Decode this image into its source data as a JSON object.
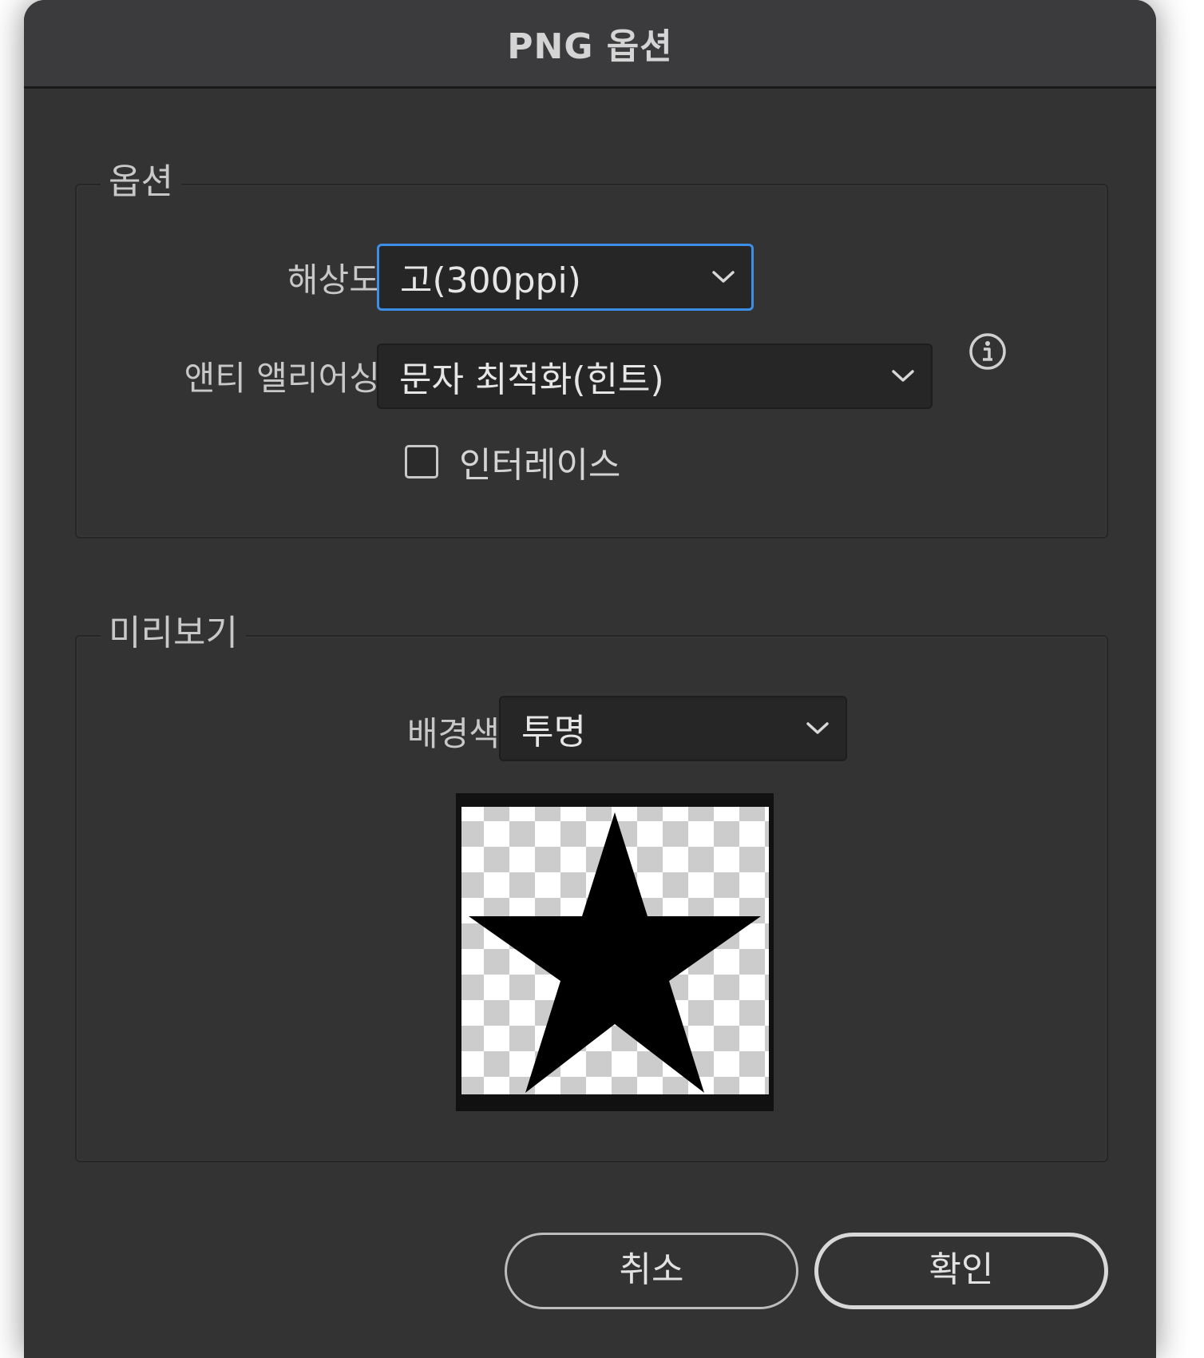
{
  "dialog": {
    "title": "PNG 옵션"
  },
  "options_group": {
    "legend": "옵션",
    "resolution": {
      "label": "해상도:",
      "value": "고(300ppi)"
    },
    "antialias": {
      "label": "앤티 앨리어싱:",
      "value": "문자 최적화(힌트)"
    },
    "interlace": {
      "label": "인터레이스",
      "checked": false
    }
  },
  "preview_group": {
    "legend": "미리보기",
    "background": {
      "label": "배경색:",
      "value": "투명"
    }
  },
  "buttons": {
    "cancel": "취소",
    "ok": "확인"
  },
  "icons": {
    "chevron": "chevron-down-icon",
    "info": "info-icon",
    "preview_shape": "star-icon"
  },
  "colors": {
    "dialog_bg": "#333333",
    "focus_ring": "#3d8ee6",
    "checker_light": "#ffffff",
    "checker_dark": "#cccccc"
  }
}
